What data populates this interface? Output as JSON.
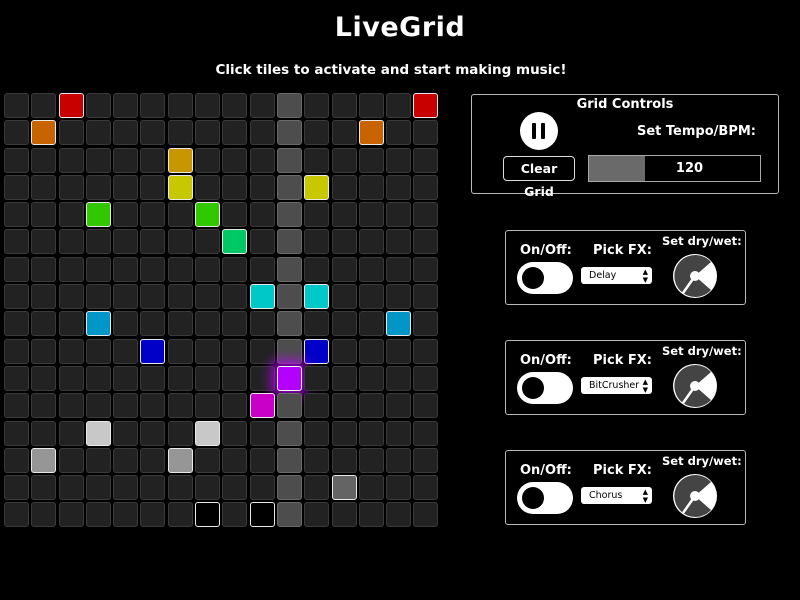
{
  "app": {
    "title": "LiveGrid",
    "subtitle": "Click tiles to activate and start making music!"
  },
  "grid": {
    "rows": 16,
    "cols": 16,
    "playhead_col": 10,
    "active_tiles": [
      {
        "row": 0,
        "col": 2,
        "color": "#c80000"
      },
      {
        "row": 0,
        "col": 15,
        "color": "#c80000"
      },
      {
        "row": 1,
        "col": 1,
        "color": "#c86400"
      },
      {
        "row": 1,
        "col": 13,
        "color": "#c86400"
      },
      {
        "row": 2,
        "col": 6,
        "color": "#c89600"
      },
      {
        "row": 3,
        "col": 6,
        "color": "#c8c800"
      },
      {
        "row": 3,
        "col": 11,
        "color": "#c8c800"
      },
      {
        "row": 4,
        "col": 3,
        "color": "#32c800"
      },
      {
        "row": 4,
        "col": 7,
        "color": "#32c800"
      },
      {
        "row": 5,
        "col": 8,
        "color": "#00c864"
      },
      {
        "row": 7,
        "col": 9,
        "color": "#00c8c8"
      },
      {
        "row": 7,
        "col": 11,
        "color": "#00c8c8"
      },
      {
        "row": 8,
        "col": 3,
        "color": "#0096c8"
      },
      {
        "row": 8,
        "col": 14,
        "color": "#0096c8"
      },
      {
        "row": 9,
        "col": 5,
        "color": "#0000c8"
      },
      {
        "row": 9,
        "col": 11,
        "color": "#0000c8"
      },
      {
        "row": 10,
        "col": 10,
        "color": "#b400ff",
        "glow": true
      },
      {
        "row": 11,
        "col": 9,
        "color": "#c800c8"
      },
      {
        "row": 12,
        "col": 3,
        "color": "#c8c8c8"
      },
      {
        "row": 12,
        "col": 7,
        "color": "#c8c8c8"
      },
      {
        "row": 13,
        "col": 1,
        "color": "#969696"
      },
      {
        "row": 13,
        "col": 6,
        "color": "#969696"
      },
      {
        "row": 14,
        "col": 12,
        "color": "#646464"
      },
      {
        "row": 15,
        "col": 7,
        "color": "#000000"
      },
      {
        "row": 15,
        "col": 9,
        "color": "#000000"
      }
    ]
  },
  "controls": {
    "title": "Grid Controls",
    "play_state": "pause-icon",
    "clear_label": "Clear Grid",
    "tempo_label": "Set Tempo/BPM:",
    "tempo_value": "120",
    "tempo_fraction": 0.33
  },
  "fx_units": [
    {
      "onoff_label": "On/Off:",
      "pick_label": "Pick FX:",
      "effect": "Delay",
      "drywet_label": "Set dry/wet:",
      "enabled": false
    },
    {
      "onoff_label": "On/Off:",
      "pick_label": "Pick FX:",
      "effect": "BitCrusher",
      "drywet_label": "Set dry/wet:",
      "enabled": false
    },
    {
      "onoff_label": "On/Off:",
      "pick_label": "Pick FX:",
      "effect": "Chorus",
      "drywet_label": "Set dry/wet:",
      "enabled": false
    }
  ]
}
